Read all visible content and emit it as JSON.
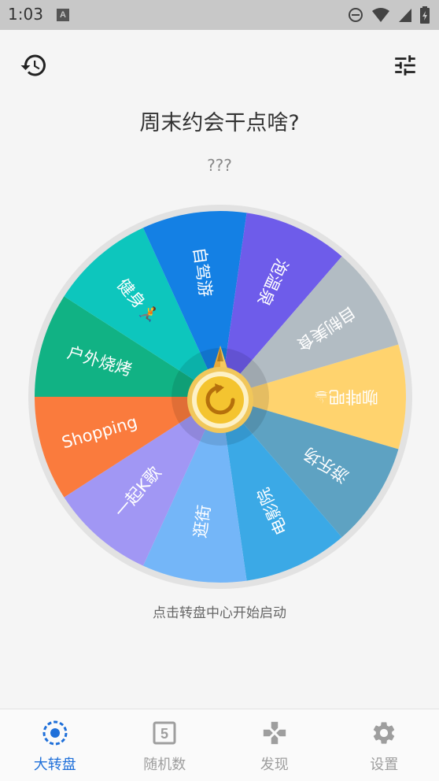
{
  "status_bar": {
    "time": "1:03",
    "notification_letter": "A"
  },
  "header": {
    "history_icon": "history-icon",
    "settings_icon": "tune-icon"
  },
  "title": "周末约会干点啥?",
  "result": "???",
  "wheel": {
    "center_icon": "refresh-icon",
    "segments": [
      {
        "label": "咖啡吧☕",
        "color": "#ffd36e"
      },
      {
        "label": "游乐场",
        "color": "#5ea2c2"
      },
      {
        "label": "电影院",
        "color": "#3ba9e6"
      },
      {
        "label": "逛街",
        "color": "#74b6f8"
      },
      {
        "label": "一起K歌",
        "color": "#a197f4"
      },
      {
        "label": "Shopping",
        "color": "#fa7b3d"
      },
      {
        "label": "户外烧烤",
        "color": "#11b284"
      },
      {
        "label": "健身🏃",
        "color": "#0dc6bd"
      },
      {
        "label": "自驾游",
        "color": "#1480e4"
      },
      {
        "label": "泡温泉",
        "color": "#6e5cea"
      },
      {
        "label": "自制美食",
        "color": "#b2bcc3"
      }
    ]
  },
  "hint": "点击转盘中心开始启动",
  "nav": [
    {
      "label": "大转盘",
      "icon": "wheel-icon",
      "active": true
    },
    {
      "label": "随机数",
      "icon": "dice-number-icon",
      "active": false
    },
    {
      "label": "发现",
      "icon": "gamepad-icon",
      "active": false
    },
    {
      "label": "设置",
      "icon": "gear-icon",
      "active": false
    }
  ],
  "colors": {
    "accent": "#1e6fd9",
    "inactive": "#9e9e9e"
  }
}
